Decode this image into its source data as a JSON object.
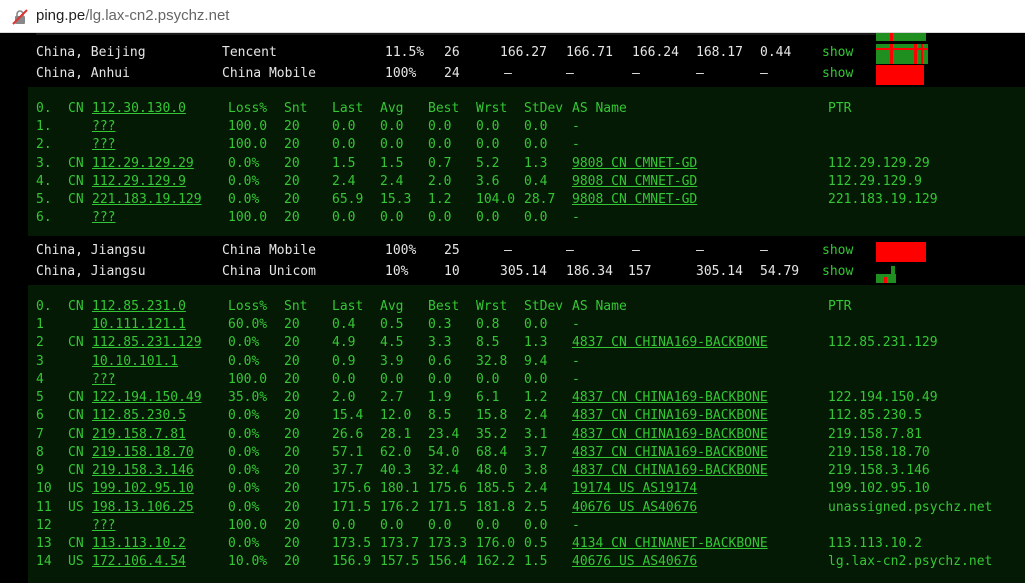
{
  "address_bar": {
    "domain": "ping.pe",
    "path": "/lg.lax-cn2.psychz.net"
  },
  "locations": [
    {
      "location": "China, Beijing",
      "isp": "Tencent",
      "loss": "11.5%",
      "snt": "26",
      "last": "166.27",
      "avg": "166.71",
      "best": "166.24",
      "wrst": "168.17",
      "stdev": "0.44",
      "show": "show"
    },
    {
      "location": "China, Anhui",
      "isp": "China Mobile",
      "loss": "100%",
      "snt": "24",
      "last": "–",
      "avg": "–",
      "best": "–",
      "wrst": "–",
      "stdev": "–",
      "show": "show"
    },
    {
      "location": "China, Jiangsu",
      "isp": "China Mobile",
      "loss": "100%",
      "snt": "25",
      "last": "–",
      "avg": "–",
      "best": "–",
      "wrst": "–",
      "stdev": "–",
      "show": "show"
    },
    {
      "location": "China, Jiangsu",
      "isp": "China Unicom",
      "loss": "10%",
      "snt": "10",
      "last": "305.14",
      "avg": "186.34",
      "best": "157",
      "wrst": "305.14",
      "stdev": "54.79",
      "show": "show"
    }
  ],
  "trace1": {
    "header": {
      "hop": "0.",
      "cc": "CN",
      "host": "112.30.130.0",
      "loss": "Loss%",
      "snt": "Snt",
      "last": "Last",
      "avg": "Avg",
      "best": "Best",
      "wrst": "Wrst",
      "stdev": "StDev",
      "asname": "AS Name",
      "ptr": "PTR"
    },
    "hops": [
      {
        "hop": "1.",
        "cc": "",
        "host": "???",
        "loss": "100.0",
        "snt": "20",
        "last": "0.0",
        "avg": "0.0",
        "best": "0.0",
        "wrst": "0.0",
        "stdev": "0.0",
        "asname": "-",
        "ptr": ""
      },
      {
        "hop": "2.",
        "cc": "",
        "host": "???",
        "loss": "100.0",
        "snt": "20",
        "last": "0.0",
        "avg": "0.0",
        "best": "0.0",
        "wrst": "0.0",
        "stdev": "0.0",
        "asname": "-",
        "ptr": ""
      },
      {
        "hop": "3.",
        "cc": "CN",
        "host": "112.29.129.29",
        "loss": "0.0%",
        "snt": "20",
        "last": "1.5",
        "avg": "1.5",
        "best": "0.7",
        "wrst": "5.2",
        "stdev": "1.3",
        "asname": "9808  CN CMNET-GD",
        "ptr": "112.29.129.29"
      },
      {
        "hop": "4.",
        "cc": "CN",
        "host": "112.29.129.9",
        "loss": "0.0%",
        "snt": "20",
        "last": "2.4",
        "avg": "2.4",
        "best": "2.0",
        "wrst": "3.6",
        "stdev": "0.4",
        "asname": "9808  CN CMNET-GD",
        "ptr": "112.29.129.9"
      },
      {
        "hop": "5.",
        "cc": "CN",
        "host": "221.183.19.129",
        "loss": "0.0%",
        "snt": "20",
        "last": "65.9",
        "avg": "15.3",
        "best": "1.2",
        "wrst": "104.0",
        "stdev": "28.7",
        "asname": "9808  CN CMNET-GD",
        "ptr": "221.183.19.129"
      },
      {
        "hop": "6.",
        "cc": "",
        "host": "???",
        "loss": "100.0",
        "snt": "20",
        "last": "0.0",
        "avg": "0.0",
        "best": "0.0",
        "wrst": "0.0",
        "stdev": "0.0",
        "asname": "-",
        "ptr": ""
      }
    ]
  },
  "trace2": {
    "header": {
      "hop": "0.",
      "cc": "CN",
      "host": "112.85.231.0",
      "loss": "Loss%",
      "snt": "Snt",
      "last": "Last",
      "avg": "Avg",
      "best": "Best",
      "wrst": "Wrst",
      "stdev": "StDev",
      "asname": "AS Name",
      "ptr": "PTR"
    },
    "hops": [
      {
        "hop": "1",
        "cc": "",
        "host": "10.111.121.1",
        "loss": "60.0%",
        "snt": "20",
        "last": "0.4",
        "avg": "0.5",
        "best": "0.3",
        "wrst": "0.8",
        "stdev": "0.0",
        "asname": "-",
        "ptr": ""
      },
      {
        "hop": "2",
        "cc": "CN",
        "host": "112.85.231.129",
        "loss": "0.0%",
        "snt": "20",
        "last": "4.9",
        "avg": "4.5",
        "best": "3.3",
        "wrst": "8.5",
        "stdev": "1.3",
        "asname": "4837  CN CHINA169-BACKBONE",
        "ptr": "112.85.231.129"
      },
      {
        "hop": "3",
        "cc": "",
        "host": "10.10.101.1",
        "loss": "0.0%",
        "snt": "20",
        "last": "0.9",
        "avg": "3.9",
        "best": "0.6",
        "wrst": "32.8",
        "stdev": "9.4",
        "asname": "-",
        "ptr": ""
      },
      {
        "hop": "4",
        "cc": "",
        "host": "???",
        "loss": "100.0",
        "snt": "20",
        "last": "0.0",
        "avg": "0.0",
        "best": "0.0",
        "wrst": "0.0",
        "stdev": "0.0",
        "asname": "-",
        "ptr": ""
      },
      {
        "hop": "5",
        "cc": "CN",
        "host": "122.194.150.49",
        "loss": "35.0%",
        "snt": "20",
        "last": "2.0",
        "avg": "2.7",
        "best": "1.9",
        "wrst": "6.1",
        "stdev": "1.2",
        "asname": "4837  CN CHINA169-BACKBONE",
        "ptr": "122.194.150.49"
      },
      {
        "hop": "6",
        "cc": "CN",
        "host": "112.85.230.5",
        "loss": "0.0%",
        "snt": "20",
        "last": "15.4",
        "avg": "12.0",
        "best": "8.5",
        "wrst": "15.8",
        "stdev": "2.4",
        "asname": "4837  CN CHINA169-BACKBONE",
        "ptr": "112.85.230.5"
      },
      {
        "hop": "7",
        "cc": "CN",
        "host": "219.158.7.81",
        "loss": "0.0%",
        "snt": "20",
        "last": "26.6",
        "avg": "28.1",
        "best": "23.4",
        "wrst": "35.2",
        "stdev": "3.1",
        "asname": "4837  CN CHINA169-BACKBONE",
        "ptr": "219.158.7.81"
      },
      {
        "hop": "8",
        "cc": "CN",
        "host": "219.158.18.70",
        "loss": "0.0%",
        "snt": "20",
        "last": "57.1",
        "avg": "62.0",
        "best": "54.0",
        "wrst": "68.4",
        "stdev": "3.7",
        "asname": "4837  CN CHINA169-BACKBONE",
        "ptr": "219.158.18.70"
      },
      {
        "hop": "9",
        "cc": "CN",
        "host": "219.158.3.146",
        "loss": "0.0%",
        "snt": "20",
        "last": "37.7",
        "avg": "40.3",
        "best": "32.4",
        "wrst": "48.0",
        "stdev": "3.8",
        "asname": "4837  CN CHINA169-BACKBONE",
        "ptr": "219.158.3.146"
      },
      {
        "hop": "10",
        "cc": "US",
        "host": "199.102.95.10",
        "loss": "0.0%",
        "snt": "20",
        "last": "175.6",
        "avg": "180.1",
        "best": "175.6",
        "wrst": "185.5",
        "stdev": "2.4",
        "asname": "19174 US AS19174",
        "ptr": "199.102.95.10"
      },
      {
        "hop": "11",
        "cc": "US",
        "host": "198.13.106.25",
        "loss": "0.0%",
        "snt": "20",
        "last": "171.5",
        "avg": "176.2",
        "best": "171.5",
        "wrst": "181.8",
        "stdev": "2.5",
        "asname": "40676 US AS40676",
        "ptr": "unassigned.psychz.net"
      },
      {
        "hop": "12",
        "cc": "",
        "host": "???",
        "loss": "100.0",
        "snt": "20",
        "last": "0.0",
        "avg": "0.0",
        "best": "0.0",
        "wrst": "0.0",
        "stdev": "0.0",
        "asname": "-",
        "ptr": ""
      },
      {
        "hop": "13",
        "cc": "CN",
        "host": "113.113.10.2",
        "loss": "0.0%",
        "snt": "20",
        "last": "173.5",
        "avg": "173.7",
        "best": "173.3",
        "wrst": "176.0",
        "stdev": "0.5",
        "asname": "4134  CN CHINANET-BACKBONE",
        "ptr": "113.113.10.2"
      },
      {
        "hop": "14",
        "cc": "US",
        "host": "172.106.4.54",
        "loss": "10.0%",
        "snt": "20",
        "last": "156.9",
        "avg": "157.5",
        "best": "156.4",
        "wrst": "162.2",
        "stdev": "1.5",
        "asname": "40676 US AS40676",
        "ptr": "lg.lax-cn2.psychz.net"
      }
    ]
  },
  "colors": {
    "terminal_green": "#35c635",
    "panel_bg": "#041a04",
    "loss_red": "#ff0000",
    "ok_green": "#22aa22"
  }
}
